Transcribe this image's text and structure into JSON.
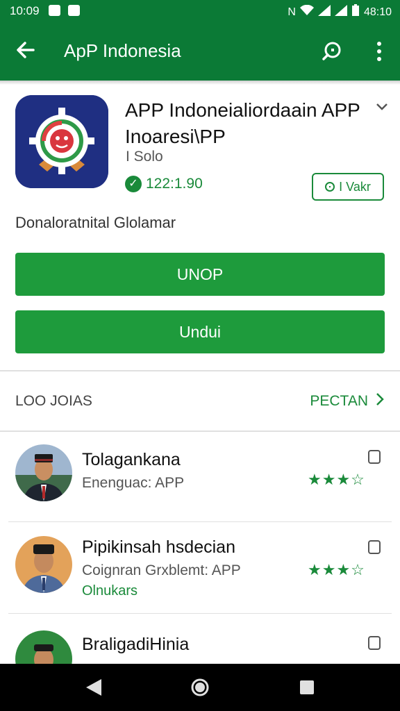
{
  "status_bar": {
    "time": "10:09",
    "clock_right": "48:10"
  },
  "app_bar": {
    "title": "ApP Indonesia"
  },
  "app": {
    "name": "APP Indoneialiordaain APP Inoaresi\\PP",
    "developer": "I Solo",
    "rating": "122:1.90",
    "outline_button": "I Vakr",
    "description": "Donaloratnital Glolamar",
    "primary_button": "UNOP",
    "download_button": "Undui"
  },
  "section": {
    "title": "LOO JOIAS",
    "more_label": "PECTAN"
  },
  "list": [
    {
      "name": "Tolagankana",
      "subtitle": "Enenguac: APP",
      "stars": "★★★☆"
    },
    {
      "name": "Pipikinsah hsdecian",
      "subtitle": "Coignran Grxblemt: APP",
      "label": "Olnukars",
      "stars": "★★★☆"
    },
    {
      "name": "BraligadiHinia",
      "subtitle": "",
      "stars": ""
    }
  ],
  "colors": {
    "primary": "#0b7a36",
    "accent": "#1e9b3c",
    "text": "#212121"
  },
  "icons": [
    "back-arrow-icon",
    "search-icon",
    "more-vert-icon",
    "chevron-down-icon",
    "check-badge-icon",
    "clock-icon",
    "chevron-right-icon",
    "bookmark-icon",
    "star-icon",
    "nav-back-icon",
    "nav-home-icon",
    "nav-recent-icon"
  ]
}
